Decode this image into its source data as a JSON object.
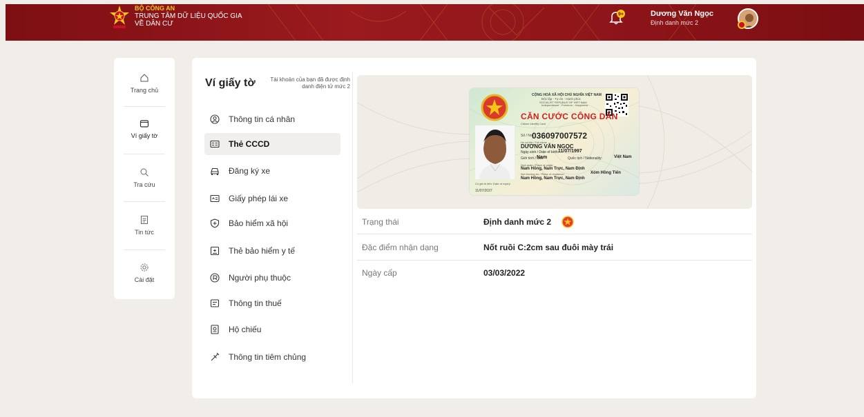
{
  "header": {
    "org_line1": "BỘ CÔNG AN",
    "org_line2": "TRUNG TÂM DỮ LIỆU QUỐC GIA",
    "org_line3": "VỀ DÂN CƯ",
    "notification_count": "9+",
    "user_name": "Dương Văn Ngọc",
    "user_level": "Định danh mức 2"
  },
  "leftnav": {
    "items": [
      {
        "label": "Trang chủ",
        "icon": "home-icon"
      },
      {
        "label": "Ví giấy tờ",
        "icon": "wallet-icon"
      },
      {
        "label": "Tra cứu",
        "icon": "search-icon"
      },
      {
        "label": "Tin tức",
        "icon": "news-icon"
      },
      {
        "label": "Cài đặt",
        "icon": "settings-icon"
      }
    ]
  },
  "wallet": {
    "title": "Ví giấy tờ",
    "note": "Tài khoản của bạn đã được định danh điện tử mức 2",
    "menu": [
      {
        "label": "Thông tin cá nhân",
        "icon": "user-circle-icon"
      },
      {
        "label": "Thẻ CCCD",
        "icon": "id-card-icon"
      },
      {
        "label": "Đăng ký xe",
        "icon": "car-icon"
      },
      {
        "label": "Giấy phép lái xe",
        "icon": "driver-license-icon"
      },
      {
        "label": "Bảo hiểm xã hội",
        "icon": "shield-plus-icon"
      },
      {
        "label": "Thẻ bảo hiểm y tế",
        "icon": "health-card-icon"
      },
      {
        "label": "Người phụ thuộc",
        "icon": "dependent-icon"
      },
      {
        "label": "Thông tin thuế",
        "icon": "tax-icon"
      },
      {
        "label": "Hộ chiếu",
        "icon": "passport-icon"
      },
      {
        "label": "Thông tin tiêm chủng",
        "icon": "syringe-icon"
      }
    ],
    "active_index": 1
  },
  "card": {
    "header1": "CỘNG HOÀ XÃ HỘI CHỦ NGHĨA VIỆT NAM",
    "header2": "Độc lập - Tự do - Hạnh phúc",
    "header3": "SOCIALIST REPUBLIC OF VIET NAM",
    "header4": "Independence - Freedom - Happiness",
    "title": "CĂN CƯỚC CÔNG DÂN",
    "subtitle": "Citizen Identity Card",
    "no_label": "Số / No.",
    "number": "036097007572",
    "name_label": "Họ và tên / Full name",
    "name": "DƯƠNG VĂN NGỌC",
    "dob_label": "Ngày sinh / Date of birth:",
    "dob": "11/07/1997",
    "sex_label": "Giới tính / Sex:",
    "sex": "Nam",
    "nationality_label": "Quốc tịch / Nationality:",
    "nationality": "Việt Nam",
    "origin_label": "Quê quán / Place of origin:",
    "origin": "Nam Hồng, Nam Trực, Nam Định",
    "residence_label": "Nơi thường trú / Place of residence:",
    "residence1": "Xóm Hồng Tiến",
    "residence2": "Nam Hồng, Nam Trực, Nam Định",
    "expiry_label": "Có giá trị đến: Date of expiry",
    "expiry": "11/07/2037"
  },
  "info": {
    "status_label": "Trạng thái",
    "status_value": "Định danh mức 2",
    "feature_label": "Đặc điểm nhận dạng",
    "feature_value": "Nốt ruồi C:2cm sau đuôi mày trái",
    "issue_label": "Ngày cấp",
    "issue_value": "03/03/2022"
  }
}
